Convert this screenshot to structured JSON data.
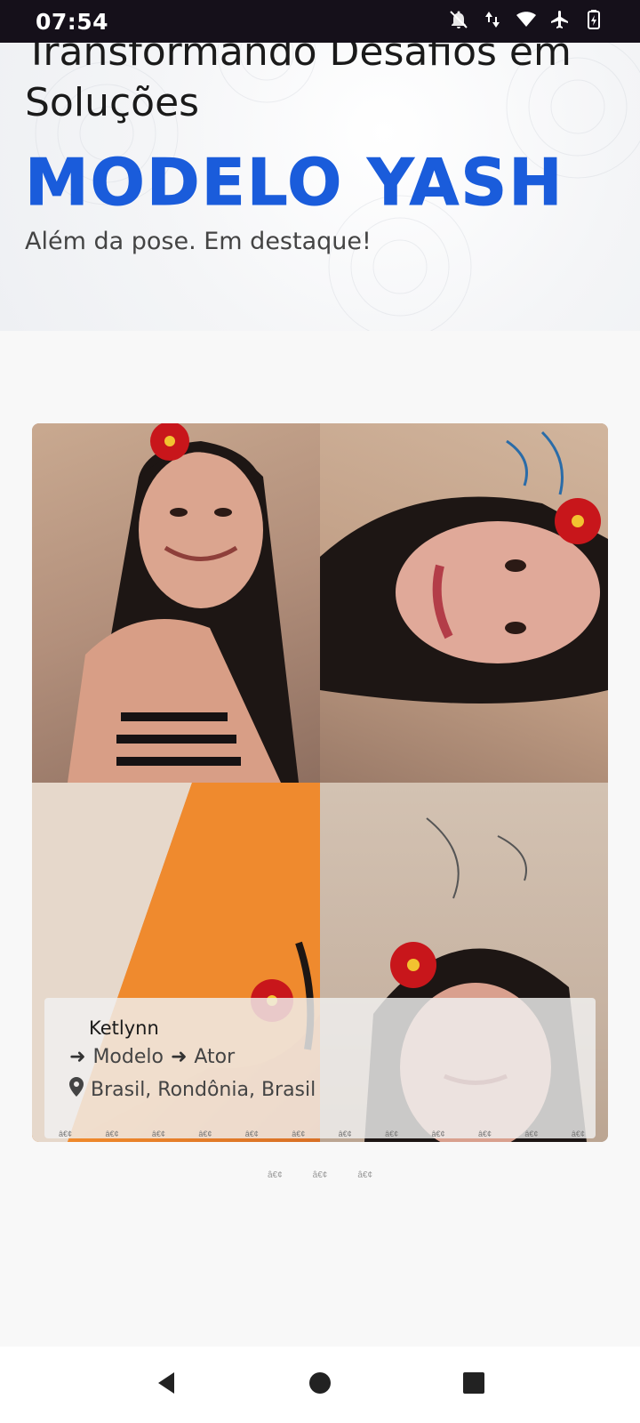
{
  "status_bar": {
    "time": "07:54",
    "icons": [
      "bell-off-icon",
      "data-icon",
      "wifi-icon",
      "airplane-icon",
      "battery-icon"
    ]
  },
  "hero": {
    "title": "Transformando Desafios em Soluções",
    "brand": "MODELO YASH",
    "tagline": "Além da pose. Em destaque!"
  },
  "card": {
    "name": "Ketlynn",
    "roles": [
      "Modelo",
      "Ator"
    ],
    "location": "Brasil, Rondônia, Brasil",
    "inner_dots": [
      "â€¢",
      "â€¢",
      "â€¢",
      "â€¢",
      "â€¢",
      "â€¢",
      "â€¢",
      "â€¢",
      "â€¢",
      "â€¢",
      "â€¢",
      "â€¢"
    ],
    "photos": [
      "photo-top-left",
      "photo-top-right",
      "photo-bottom-left",
      "photo-bottom-right"
    ]
  },
  "pager": [
    "â€¢",
    "â€¢",
    "â€¢"
  ],
  "nav": [
    "back-icon",
    "home-icon",
    "recents-icon"
  ],
  "colors": {
    "brand_blue": "#1a5cdb",
    "status_bar": "#15101a"
  }
}
